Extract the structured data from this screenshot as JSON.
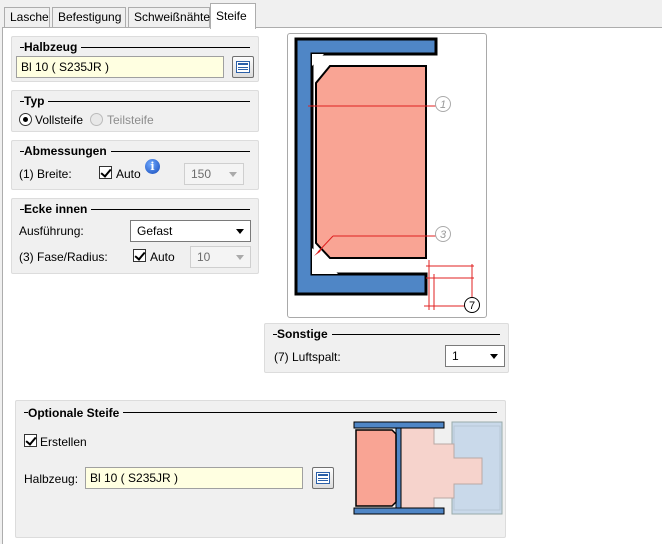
{
  "tabs": [
    {
      "label": "Lasche"
    },
    {
      "label": "Befestigung"
    },
    {
      "label": "Schweißnähte"
    },
    {
      "label": "Steife"
    }
  ],
  "halbzeug": {
    "title": "Halbzeug",
    "value": "Bl 10  ( S235JR )"
  },
  "typ": {
    "title": "Typ",
    "option1": "Vollsteife",
    "option2": "Teilsteife"
  },
  "abmessungen": {
    "title": "Abmessungen",
    "breite_label": "(1) Breite:",
    "auto_label": "Auto",
    "info_glyph": "i",
    "value": "150"
  },
  "ecke": {
    "title": "Ecke innen",
    "ausfuehrung_label": "Ausführung:",
    "ausfuehrung_value": "Gefast",
    "fase_label": "(3) Fase/Radius:",
    "auto_label": "Auto",
    "value": "10"
  },
  "diagram": {
    "callout1": "1",
    "callout3": "3",
    "callout7": "7"
  },
  "sonstige": {
    "title": "Sonstige",
    "luftspalt_label": "(7) Luftspalt:",
    "luftspalt_value": "1"
  },
  "optional": {
    "title": "Optionale Steife",
    "erstellen_label": "Erstellen",
    "halbzeug_label": "Halbzeug:",
    "halbzeug_value": "Bl 10  ( S235JR )"
  },
  "colors": {
    "steel_blue": "#4f86c6",
    "stiffener_salmon": "#f9a494",
    "dim_red": "#e02020"
  }
}
